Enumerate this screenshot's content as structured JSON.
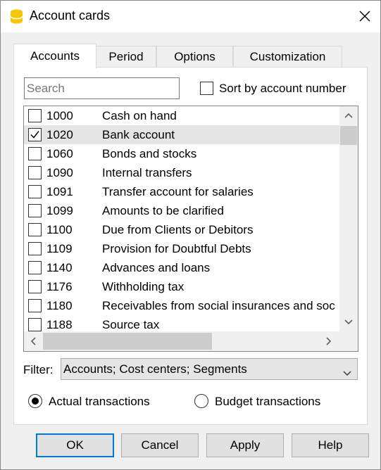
{
  "window": {
    "title": "Account cards",
    "icon": "banana-app-icon",
    "close_icon": "close-icon"
  },
  "tabs": [
    {
      "label": "Accounts",
      "active": true
    },
    {
      "label": "Period",
      "active": false
    },
    {
      "label": "Options",
      "active": false
    },
    {
      "label": "Customization",
      "active": false
    }
  ],
  "search": {
    "placeholder": "Search",
    "value": ""
  },
  "sort": {
    "label": "Sort by account number",
    "checked": false
  },
  "accounts": [
    {
      "number": "1000",
      "description": "Cash on hand",
      "checked": false,
      "selected": false
    },
    {
      "number": "1020",
      "description": "Bank account",
      "checked": true,
      "selected": true
    },
    {
      "number": "1060",
      "description": "Bonds and stocks",
      "checked": false,
      "selected": false
    },
    {
      "number": "1090",
      "description": "Internal transfers",
      "checked": false,
      "selected": false
    },
    {
      "number": "1091",
      "description": "Transfer account for salaries",
      "checked": false,
      "selected": false
    },
    {
      "number": "1099",
      "description": "Amounts to be clarified",
      "checked": false,
      "selected": false
    },
    {
      "number": "1100",
      "description": "Due from Clients or Debitors",
      "checked": false,
      "selected": false
    },
    {
      "number": "1109",
      "description": "Provision for Doubtful Debts",
      "checked": false,
      "selected": false
    },
    {
      "number": "1140",
      "description": "Advances and loans",
      "checked": false,
      "selected": false
    },
    {
      "number": "1176",
      "description": "Withholding tax",
      "checked": false,
      "selected": false
    },
    {
      "number": "1180",
      "description": "Receivables from social insurances and soc",
      "checked": false,
      "selected": false
    },
    {
      "number": "1188",
      "description": "Source tax",
      "checked": false,
      "selected": false
    }
  ],
  "filter": {
    "label": "Filter:",
    "value": "Accounts; Cost centers; Segments"
  },
  "transactions": {
    "actual_label": "Actual transactions",
    "budget_label": "Budget transactions",
    "selected": "actual"
  },
  "buttons": {
    "ok": "OK",
    "cancel": "Cancel",
    "apply": "Apply",
    "help": "Help"
  },
  "colors": {
    "accent": "#0078d7",
    "icon_yellow": "#f7c600",
    "selection": "#e5e5e5"
  }
}
